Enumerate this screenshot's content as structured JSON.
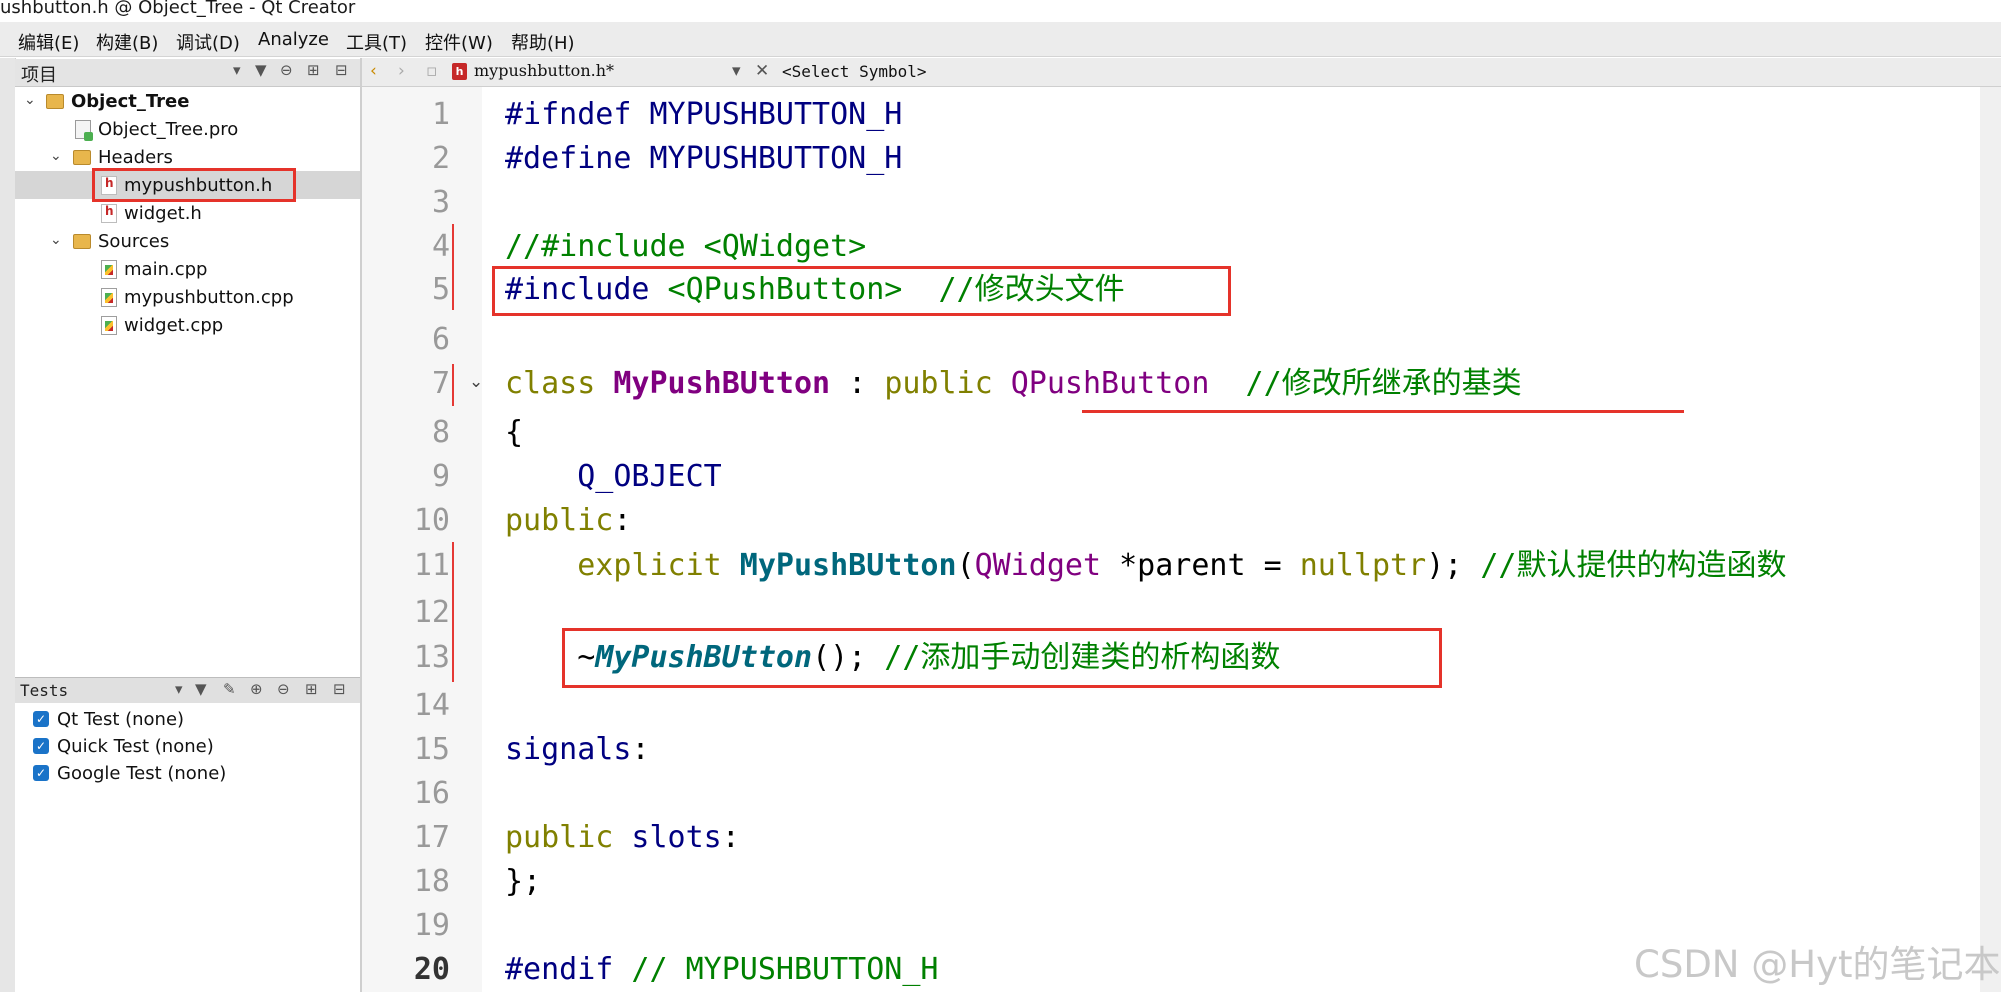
{
  "window": {
    "title": "ushbutton.h @ Object_Tree - Qt Creator"
  },
  "menu": [
    {
      "label": "编辑(E)"
    },
    {
      "label": "构建(B)"
    },
    {
      "label": "调试(D)"
    },
    {
      "label": "Analyze"
    },
    {
      "label": "工具(T)"
    },
    {
      "label": "控件(W)"
    },
    {
      "label": "帮助(H)"
    }
  ],
  "project_panel": {
    "header": "项目",
    "tree": [
      {
        "label": "Object_Tree",
        "icon": "project-folder-icon",
        "bold": true
      },
      {
        "label": "Object_Tree.pro",
        "icon": "pro-file-icon"
      },
      {
        "label": "Headers",
        "icon": "folder-icon"
      },
      {
        "label": "mypushbutton.h",
        "icon": "header-file-icon",
        "selected": true
      },
      {
        "label": "widget.h",
        "icon": "header-file-icon"
      },
      {
        "label": "Sources",
        "icon": "folder-icon"
      },
      {
        "label": "main.cpp",
        "icon": "cpp-file-icon"
      },
      {
        "label": "mypushbutton.cpp",
        "icon": "cpp-file-icon"
      },
      {
        "label": "widget.cpp",
        "icon": "cpp-file-icon"
      }
    ]
  },
  "tests_panel": {
    "header": "Tests",
    "items": [
      {
        "label": "Qt Test (none)",
        "checked": true
      },
      {
        "label": "Quick Test (none)",
        "checked": true
      },
      {
        "label": "Google Test (none)",
        "checked": true
      }
    ]
  },
  "editor": {
    "tab_file": "mypushbutton.h*",
    "symbol_selector": "<Select Symbol>",
    "current_line": 20,
    "line_numbers": [
      "1",
      "2",
      "3",
      "4",
      "5",
      "6",
      "7",
      "8",
      "9",
      "10",
      "11",
      "12",
      "13",
      "14",
      "15",
      "16",
      "17",
      "18",
      "19",
      "20"
    ],
    "code": {
      "l1": {
        "pre": "#ifndef",
        "name": " MYPUSHBUTTON_H"
      },
      "l2": {
        "pre": "#define",
        "name": " MYPUSHBUTTON_H"
      },
      "l4": {
        "comment": "//#include <QWidget>"
      },
      "l5": {
        "pre": "#include",
        "header": " <QPushButton>",
        "comment": "  //修改头文件"
      },
      "l7": {
        "kw1": "class",
        "cls": " MyPushBUtton",
        "sep": " : ",
        "kw2": "public",
        "base": " QPushButton",
        "comment": "  //修改所继承的基类"
      },
      "l8": {
        "text": "{"
      },
      "l9": {
        "indent": "    ",
        "macro": "Q_OBJECT"
      },
      "l10": {
        "kw": "public",
        "colon": ":"
      },
      "l11": {
        "indent": "    ",
        "kw": "explicit",
        "fn": " MyPushBUtton",
        "paren1": "(",
        "type": "QWidget",
        "rest": " *parent = ",
        "kw2": "nullptr",
        "end": ");",
        "comment": " //默认提供的构造函数"
      },
      "l13": {
        "indent": "    ",
        "tilde": "~",
        "fn": "MyPushBUtton",
        "end": "();",
        "comment": " //添加手动创建类的析构函数"
      },
      "l15": {
        "kw": "signals",
        "colon": ":"
      },
      "l17": {
        "kw": "public",
        "kw2": " slots",
        "colon": ":"
      },
      "l18": {
        "text": "};"
      },
      "l20": {
        "pre": "#endif",
        "comment": " // MYPUSHBUTTON_H"
      }
    }
  },
  "watermark": "CSDN @Hyt的笔记本",
  "colors": {
    "highlight_box": "#e5332a",
    "preprocessor": "#000080",
    "keyword": "#808000",
    "type": "#800080",
    "function": "#00677c",
    "comment": "#008000"
  }
}
